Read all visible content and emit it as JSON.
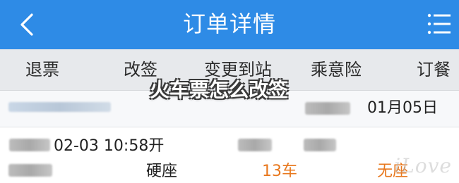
{
  "header": {
    "title": "订单详情",
    "back_icon": "chevron-left-icon",
    "menu_icon": "menu-icon",
    "background": "#2e8be6"
  },
  "actions": [
    {
      "label": "退票"
    },
    {
      "label": "改签"
    },
    {
      "label": "变更到站"
    },
    {
      "label": "乘意险"
    },
    {
      "label": "订餐"
    }
  ],
  "order": {
    "date_visible": "01月05日"
  },
  "ticket": {
    "time_visible": "02-03  10:58开",
    "seat_type": "硬座",
    "car": "13车",
    "seat": "无座",
    "accent_color": "#e8781e"
  },
  "overlay": {
    "caption": "火车票怎么改签"
  },
  "watermark": {
    "text": "iLove"
  }
}
